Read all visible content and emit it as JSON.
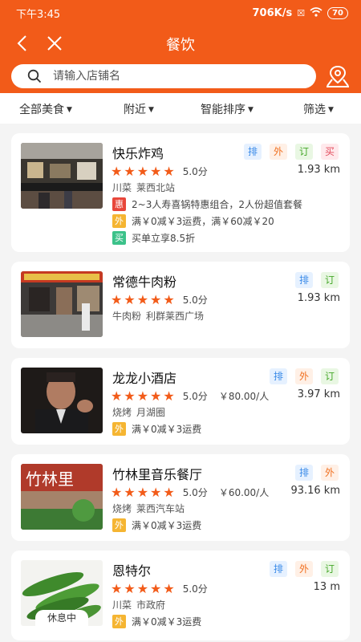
{
  "status_bar": {
    "time": "下午3:45",
    "network_speed": "706K/s",
    "battery": "70"
  },
  "nav": {
    "title": "餐饮",
    "back_icon": "back-arrow-icon",
    "close_icon": "close-icon"
  },
  "search": {
    "placeholder": "请输入店铺名",
    "map_icon": "map-location-icon"
  },
  "filters": [
    {
      "label": "全部美食"
    },
    {
      "label": "附近"
    },
    {
      "label": "智能排序"
    },
    {
      "label": "筛选"
    }
  ],
  "tag_labels": {
    "pai": "排",
    "wai": "外",
    "ding": "订",
    "mai": "买"
  },
  "shops": [
    {
      "name": "快乐炸鸡",
      "tags": [
        "排",
        "外",
        "订",
        "买"
      ],
      "stars": "★★★★★",
      "score": "5.0分",
      "avg_price": "",
      "distance": "1.93 km",
      "category": "川菜",
      "area": "莱西北站",
      "promos": [
        {
          "badge": "惠",
          "text": "2~3人寿喜锅特惠组合，2人份超值套餐"
        },
        {
          "badge": "外",
          "text": "满￥0减￥3运费，满￥60减￥20"
        },
        {
          "badge": "买",
          "text": "买单立享8.5折"
        }
      ]
    },
    {
      "name": "常德牛肉粉",
      "tags": [
        "排",
        "订"
      ],
      "stars": "★★★★★",
      "score": "5.0分",
      "avg_price": "",
      "distance": "1.93 km",
      "category": "牛肉粉",
      "area": "利群莱西广场",
      "promos": []
    },
    {
      "name": "龙龙小酒店",
      "tags": [
        "排",
        "外",
        "订"
      ],
      "stars": "★★★★★",
      "score": "5.0分",
      "avg_price": "￥80.00/人",
      "distance": "3.97 km",
      "category": "烧烤",
      "area": "月湖圈",
      "promos": [
        {
          "badge": "外",
          "text": "满￥0减￥3运费"
        }
      ]
    },
    {
      "name": "竹林里音乐餐厅",
      "tags": [
        "排",
        "外"
      ],
      "stars": "★★★★★",
      "score": "5.0分",
      "avg_price": "￥60.00/人",
      "distance": "93.16 km",
      "category": "烧烤",
      "area": "莱西汽车站",
      "promos": [
        {
          "badge": "外",
          "text": "满￥0减￥3运费"
        }
      ]
    },
    {
      "name": "恩特尔",
      "tags": [
        "排",
        "外",
        "订"
      ],
      "stars": "★★★★★",
      "score": "5.0分",
      "avg_price": "",
      "distance": "13 m",
      "category": "川菜",
      "area": "市政府",
      "status_badge": "休息中",
      "promos": [
        {
          "badge": "外",
          "text": "满￥0减￥3运费"
        }
      ]
    }
  ],
  "colors": {
    "brand": "#f25b19",
    "star": "#f25b19"
  }
}
